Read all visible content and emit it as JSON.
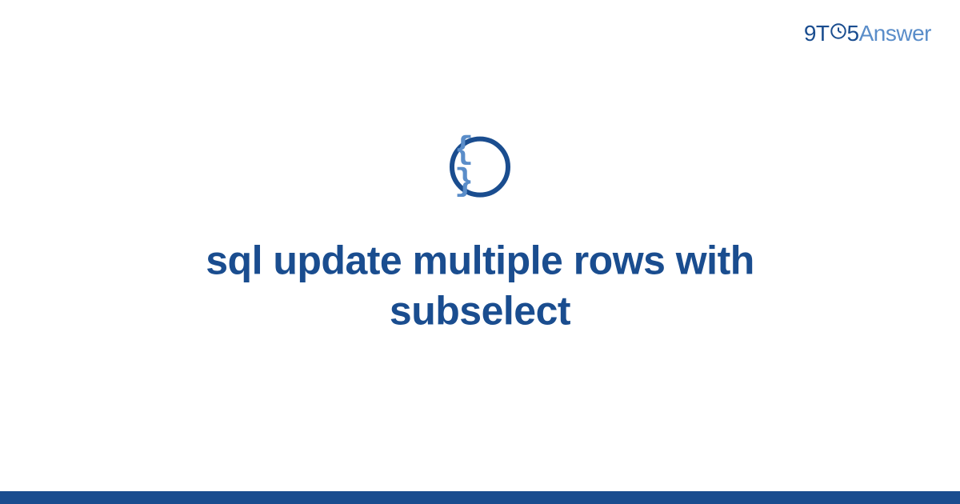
{
  "brand": {
    "part1": "9T",
    "part2": "5",
    "part3": "Answer"
  },
  "icon": {
    "name": "code-braces-icon",
    "glyph": "{ }"
  },
  "page": {
    "title": "sql update multiple rows with subselect"
  },
  "colors": {
    "primary": "#1a4d8f",
    "accent": "#5a8dc9"
  }
}
